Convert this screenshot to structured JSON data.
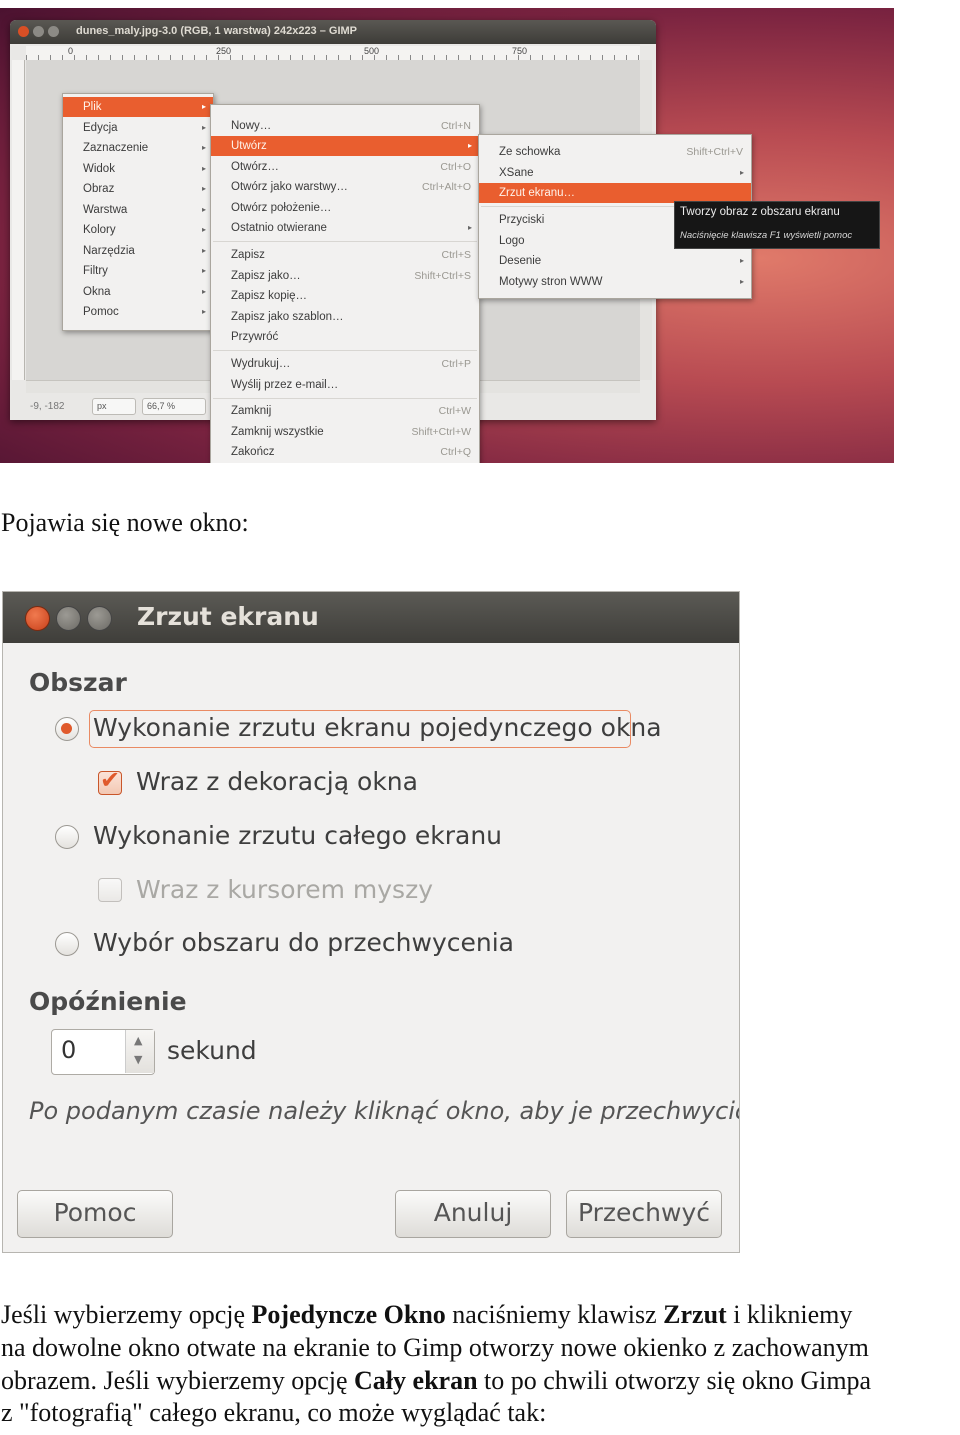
{
  "gimp": {
    "window_title": "dunes_maly.jpg-3.0 (RGB, 1 warstwa) 242x223 – GIMP",
    "ruler_ticks": [
      "0",
      "250",
      "500",
      "750"
    ],
    "status": {
      "coords": "-9, -182",
      "unit": "px",
      "zoom": "66,7 %"
    },
    "main_menu": [
      "Plik",
      "Edycja",
      "Zaznaczenie",
      "Widok",
      "Obraz",
      "Warstwa",
      "Kolory",
      "Narzędzia",
      "Filtry",
      "Okna",
      "Pomoc"
    ],
    "file_menu": [
      {
        "label": "Nowy…",
        "shortcut": "Ctrl+N"
      },
      {
        "label": "Utwórz",
        "shortcut": ""
      },
      {
        "label": "Otwórz…",
        "shortcut": "Ctrl+O"
      },
      {
        "label": "Otwórz jako warstwy…",
        "shortcut": "Ctrl+Alt+O"
      },
      {
        "label": "Otwórz położenie…",
        "shortcut": ""
      },
      {
        "label": "Ostatnio otwierane",
        "shortcut": ""
      },
      {
        "label": "Zapisz",
        "shortcut": "Ctrl+S"
      },
      {
        "label": "Zapisz jako…",
        "shortcut": "Shift+Ctrl+S"
      },
      {
        "label": "Zapisz kopię…",
        "shortcut": ""
      },
      {
        "label": "Zapisz jako szablon…",
        "shortcut": ""
      },
      {
        "label": "Przywróć",
        "shortcut": ""
      },
      {
        "label": "Wydrukuj…",
        "shortcut": "Ctrl+P"
      },
      {
        "label": "Wyślij przez e-mail…",
        "shortcut": ""
      },
      {
        "label": "Zamknij",
        "shortcut": "Ctrl+W"
      },
      {
        "label": "Zamknij wszystkie",
        "shortcut": "Shift+Ctrl+W"
      },
      {
        "label": "Zakończ",
        "shortcut": "Ctrl+Q"
      }
    ],
    "create_menu": [
      {
        "label": "Ze schowka",
        "shortcut": "Shift+Ctrl+V"
      },
      {
        "label": "XSane",
        "shortcut": ""
      },
      {
        "label": "Zrzut ekranu…",
        "shortcut": ""
      },
      {
        "label": "Przyciski",
        "shortcut": ""
      },
      {
        "label": "Logo",
        "shortcut": ""
      },
      {
        "label": "Desenie",
        "shortcut": ""
      },
      {
        "label": "Motywy stron WWW",
        "shortcut": ""
      }
    ],
    "tooltip": {
      "title": "Tworzy obraz z obszaru ekranu",
      "hint": "Naciśnięcie klawisza F1 wyświetli pomoc"
    }
  },
  "caption1": "Pojawia się nowe okno:",
  "dialog": {
    "title": "Zrzut ekranu",
    "area_heading": "Obszar",
    "option_single_window": "Wykonanie zrzutu ekranu pojedynczego okna",
    "option_decoration": "Wraz z dekoracją okna",
    "option_full_screen": "Wykonanie zrzutu całego ekranu",
    "option_cursor": "Wraz z kursorem myszy",
    "option_region": "Wybór obszaru do przechwycenia",
    "delay_heading": "Opóźnienie",
    "delay_value": "0",
    "delay_unit": "sekund",
    "hint": "Po podanym czasie należy kliknąć okno, aby je przechwycić.",
    "btn_help": "Pomoc",
    "btn_cancel": "Anuluj",
    "btn_capture": "Przechwyć"
  },
  "paragraph": {
    "l1_a": "Jeśli wybierzemy opcję ",
    "l1_b": "Pojedyncze Okno",
    "l1_c": " naciśniemy klawisz ",
    "l1_d": "Zrzut",
    "l1_e": " i klikniemy",
    "l2": "na dowolne okno otwate na ekranie to Gimp otworzy nowe okienko z zachowanym",
    "l3_a": "obrazem. Jeśli wybierzemy opcję ",
    "l3_b": "Cały ekran",
    "l3_c": " to po chwili otworzy się okno Gimpa",
    "l4": "z \"fotografią\" całego ekranu, co może wyglądać tak:"
  }
}
